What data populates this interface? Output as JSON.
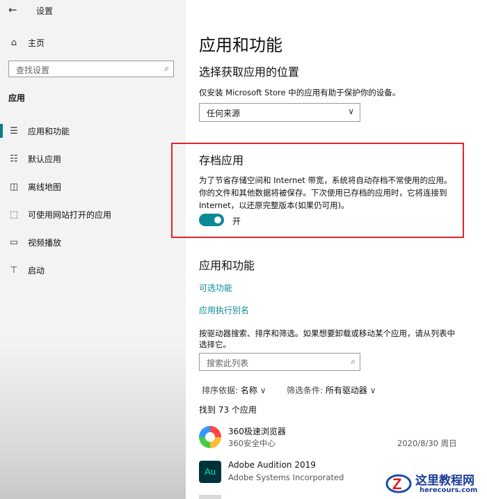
{
  "window": {
    "title": "设置",
    "back_icon": "back-arrow-icon"
  },
  "sidebar": {
    "home_label": "主页",
    "search_placeholder": "查找设置",
    "section_label": "应用",
    "items": [
      {
        "label": "应用和功能",
        "icon": "apps-list-icon",
        "active": true
      },
      {
        "label": "默认应用",
        "icon": "default-apps-icon",
        "active": false
      },
      {
        "label": "离线地图",
        "icon": "offline-maps-icon",
        "active": false
      },
      {
        "label": "可使用网站打开的应用",
        "icon": "websites-apps-icon",
        "active": false
      },
      {
        "label": "视频播放",
        "icon": "video-playback-icon",
        "active": false
      },
      {
        "label": "启动",
        "icon": "startup-icon",
        "active": false
      }
    ]
  },
  "main": {
    "page_title": "应用和功能",
    "install_section": {
      "heading": "选择获取应用的位置",
      "description": "仅安装 Microsoft Store 中的应用有助于保护你的设备。",
      "dropdown_value": "任何来源"
    },
    "archive_section": {
      "heading": "存档应用",
      "description_lines": [
        "为了节省存储空间和 Internet 带宽，系统将自动存档不常使用的应用。",
        "你的文件和其他数据将被保存。下次使用已存档的应用时，它将连接到",
        "Internet，以还原完整版本(如果仍可用)。"
      ],
      "toggle_label": "开",
      "toggle_on": true
    },
    "apps_section": {
      "heading": "应用和功能",
      "links": [
        "可选功能",
        "应用执行别名"
      ],
      "description_lines": [
        "按驱动器搜索、排序和筛选。如果想要卸载或移动某个应用，请从列表中",
        "选择它。"
      ],
      "search_placeholder": "搜索此列表",
      "sort_label": "排序依据:",
      "sort_value": "名称",
      "filter_label": "筛选条件:",
      "filter_value": "所有驱动器",
      "count_text": "找到 73 个应用",
      "apps": [
        {
          "name": "360极速浏览器",
          "publisher": "360安全中心",
          "date": "2020/8/30 周日",
          "icon": "360-browser-icon"
        },
        {
          "name": "Adobe Audition 2019",
          "publisher": "Adobe Systems Incorporated",
          "date": "",
          "icon": "adobe-audition-icon",
          "icon_text": "Au"
        }
      ]
    }
  },
  "watermark": {
    "text": "这里教程网",
    "url": "herecours.com"
  },
  "colors": {
    "accent": "#0b8a95",
    "highlight_box": "#e0242a",
    "audition_bg": "#00323a",
    "audition_fg": "#00e4bb"
  }
}
